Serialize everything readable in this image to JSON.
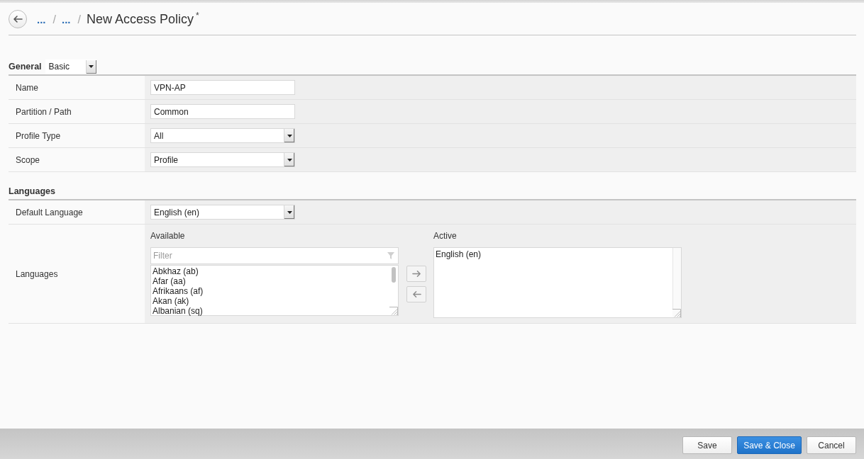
{
  "header": {
    "breadcrumb": [
      {
        "kind": "link",
        "text": "..."
      },
      {
        "kind": "separator",
        "text": "/"
      },
      {
        "kind": "link",
        "text": "..."
      },
      {
        "kind": "separator",
        "text": "/"
      }
    ],
    "title": "New Access Policy",
    "unsaved_mark": "*"
  },
  "general": {
    "title": "General",
    "view": "Basic",
    "fields": [
      {
        "label": "Name",
        "kind": "text",
        "value": "VPN-AP"
      },
      {
        "label": "Partition / Path",
        "kind": "text",
        "value": "Common"
      },
      {
        "label": "Profile Type",
        "kind": "select",
        "value": "All"
      },
      {
        "label": "Scope",
        "kind": "select",
        "value": "Profile"
      }
    ]
  },
  "languages": {
    "title": "Languages",
    "default_language": {
      "label": "Default Language",
      "value": "English (en)"
    },
    "selector": {
      "label": "Languages",
      "available": {
        "label": "Available",
        "filter_placeholder": "Filter",
        "items": [
          "Abkhaz (ab)",
          "Afar (aa)",
          "Afrikaans (af)",
          "Akan (ak)",
          "Albanian (sq)"
        ]
      },
      "active": {
        "label": "Active",
        "items": [
          "English (en)"
        ]
      }
    }
  },
  "footer": {
    "buttons": [
      {
        "label": "Save",
        "kind": "default"
      },
      {
        "label": "Save & Close",
        "kind": "primary"
      },
      {
        "label": "Cancel",
        "kind": "default"
      }
    ]
  }
}
